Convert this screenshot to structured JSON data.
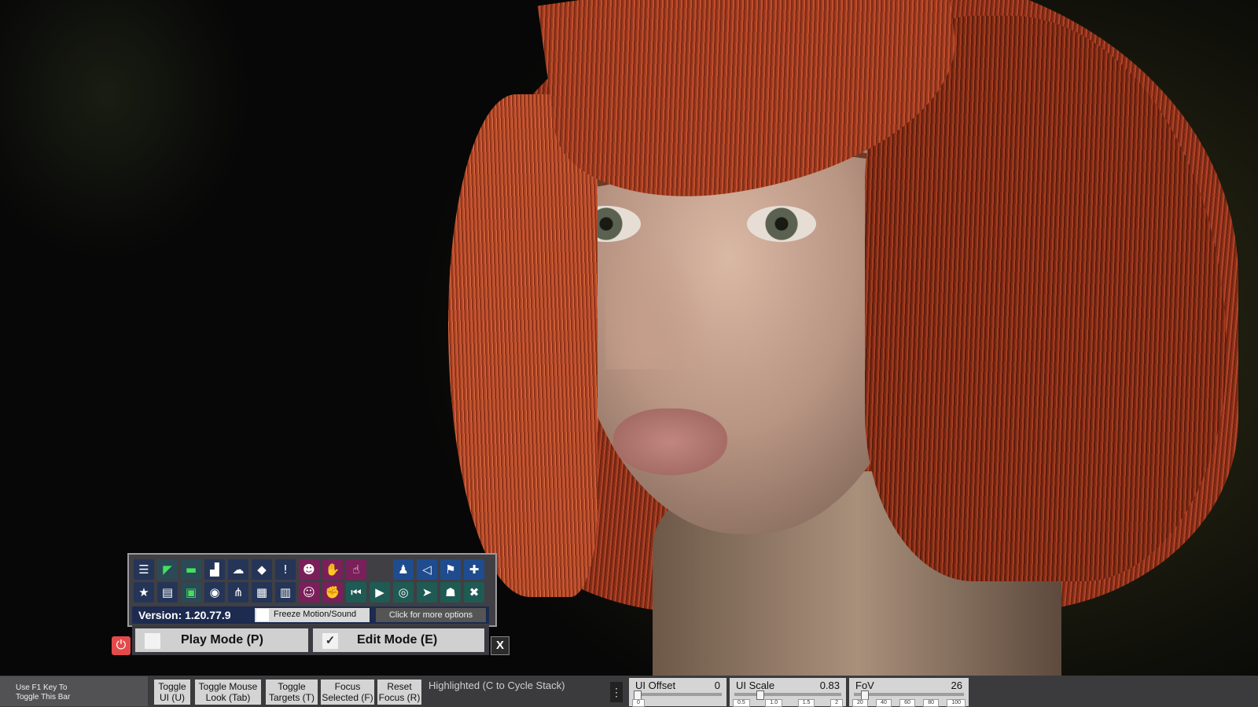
{
  "toolbar": {
    "row1_icons": [
      {
        "name": "menu-icon",
        "glyph": "☰",
        "style": "dk"
      },
      {
        "name": "save-icon",
        "glyph": "◤",
        "style": "gr"
      },
      {
        "name": "folder-icon",
        "glyph": "▬",
        "style": "gr"
      },
      {
        "name": "clear-scene-icon",
        "glyph": "▟",
        "style": "dk"
      },
      {
        "name": "cloud-icon",
        "glyph": "☁",
        "style": "dk"
      },
      {
        "name": "cube-icon",
        "glyph": "◆",
        "style": "dk"
      },
      {
        "name": "alert-icon",
        "glyph": "!",
        "style": "dk"
      },
      {
        "name": "person-settings-icon",
        "glyph": "☻",
        "style": "pk"
      },
      {
        "name": "hand-icon",
        "glyph": "✋",
        "style": "pk"
      },
      {
        "name": "pointer-hand-icon",
        "glyph": "☝",
        "style": "pk"
      },
      {
        "name": "spacer",
        "glyph": "",
        "style": "gap"
      },
      {
        "name": "person-icon",
        "glyph": "♟",
        "style": "bl"
      },
      {
        "name": "unity-icon",
        "glyph": "◁",
        "style": "bl"
      },
      {
        "name": "flag-icon",
        "glyph": "⚑",
        "style": "bl"
      },
      {
        "name": "plus-icon",
        "glyph": "✚",
        "style": "bl"
      }
    ],
    "row2_icons": [
      {
        "name": "star-icon",
        "glyph": "★",
        "style": "dk"
      },
      {
        "name": "save-as-icon",
        "glyph": "▤",
        "style": "dk"
      },
      {
        "name": "folder-camera-icon",
        "glyph": "▣",
        "style": "gr"
      },
      {
        "name": "camera-icon",
        "glyph": "◉",
        "style": "dk"
      },
      {
        "name": "share-icon",
        "glyph": "⋔",
        "style": "dk"
      },
      {
        "name": "package-icon",
        "glyph": "▦",
        "style": "dk"
      },
      {
        "name": "document-icon",
        "glyph": "▥",
        "style": "dk"
      },
      {
        "name": "person-gear-icon",
        "glyph": "☺",
        "style": "pk"
      },
      {
        "name": "hand-grab-icon",
        "glyph": "✊",
        "style": "pk"
      },
      {
        "name": "skip-back-icon",
        "glyph": "⏮",
        "style": "tl"
      },
      {
        "name": "play-icon",
        "glyph": "▶",
        "style": "tl"
      },
      {
        "name": "target-icon",
        "glyph": "◎",
        "style": "tl"
      },
      {
        "name": "cursor-icon",
        "glyph": "➤",
        "style": "tl"
      },
      {
        "name": "people-icon",
        "glyph": "☗",
        "style": "tl"
      },
      {
        "name": "tools-icon",
        "glyph": "✖",
        "style": "tl"
      }
    ],
    "version": "Version: 1.20.77.9",
    "freeze_label": "Freeze Motion/Sound",
    "more_options": "Click for more options",
    "play_mode": "Play Mode (P)",
    "edit_mode": "Edit Mode (E)",
    "edit_checked": "✓",
    "power_glyph": "⏻",
    "close_label": "X"
  },
  "bottom": {
    "f1_line1": "Use F1 Key To",
    "f1_line2": "Toggle This Bar",
    "buttons": [
      {
        "l1": "Toggle",
        "l2": "UI (U)"
      },
      {
        "l1": "Toggle Mouse",
        "l2": "Look (Tab)"
      },
      {
        "l1": "Toggle",
        "l2": "Targets (T)"
      },
      {
        "l1": "Focus",
        "l2": "Selected (F)"
      },
      {
        "l1": "Reset",
        "l2": "Focus (R)"
      }
    ],
    "highlighted": "Highlighted (C to Cycle Stack)",
    "menu_glyph": "⋮",
    "ui_offset": {
      "label": "UI Offset",
      "value": "0",
      "level": 0.0,
      "ticks": [
        "0"
      ]
    },
    "ui_scale": {
      "label": "UI Scale",
      "value": "0.83",
      "level": 0.22,
      "ticks": [
        "0.5",
        "1.0",
        "1.5",
        "2"
      ]
    },
    "fov": {
      "label": "FoV",
      "value": "26",
      "level": 0.07,
      "ticks": [
        "20",
        "40",
        "60",
        "80",
        "100"
      ]
    }
  }
}
